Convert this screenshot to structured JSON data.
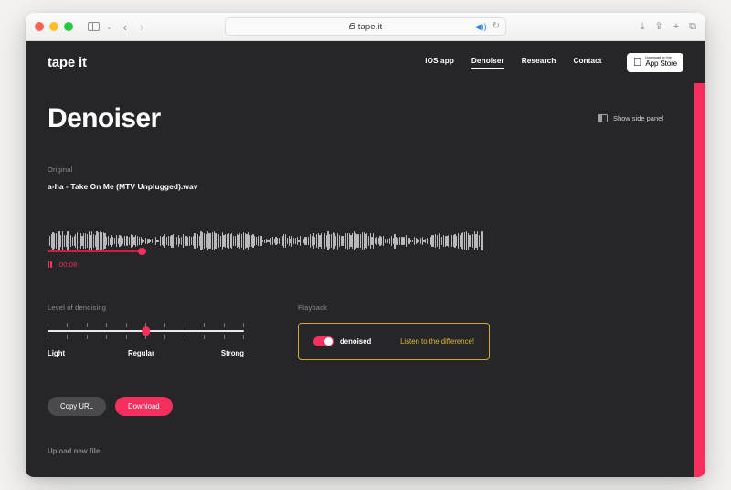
{
  "browser": {
    "url": "tape.it",
    "icons": {
      "sidebar": "sidebar-icon",
      "back": "‹",
      "forward": "›",
      "chevron": "⌄",
      "speaker": "🔊",
      "reload": "↻",
      "downloads": "⤓",
      "share": "⇪",
      "new_tab": "+",
      "tab_overview": "⧉"
    }
  },
  "app": {
    "logo": "tape it",
    "nav": [
      {
        "label": "iOS app",
        "active": false
      },
      {
        "label": "Denoiser",
        "active": true
      },
      {
        "label": "Research",
        "active": false
      },
      {
        "label": "Contact",
        "active": false
      }
    ],
    "appstore": {
      "small": "Download on the",
      "big": "App Store"
    }
  },
  "main": {
    "title": "Denoiser",
    "side_panel_label": "Show side panel",
    "original_label": "Original",
    "file_name": "a-ha - Take On Me (MTV Unplugged).wav",
    "player": {
      "current_time": "00:08",
      "progress_percent": 21
    },
    "denoise": {
      "label": "Level of denoising",
      "min_label": "Light",
      "mid_label": "Regular",
      "max_label": "Strong",
      "value": "Regular",
      "tick_count": 11
    },
    "playback": {
      "label": "Playback",
      "toggle_label": "denoised",
      "toggle_on": true,
      "hint": "Listen to the difference!"
    },
    "actions": {
      "copy_url": "Copy URL",
      "download": "Download"
    },
    "upload_link": "Upload new file"
  },
  "colors": {
    "accent": "#f62f5e",
    "background": "#262628",
    "gold": "#d2a93a"
  }
}
